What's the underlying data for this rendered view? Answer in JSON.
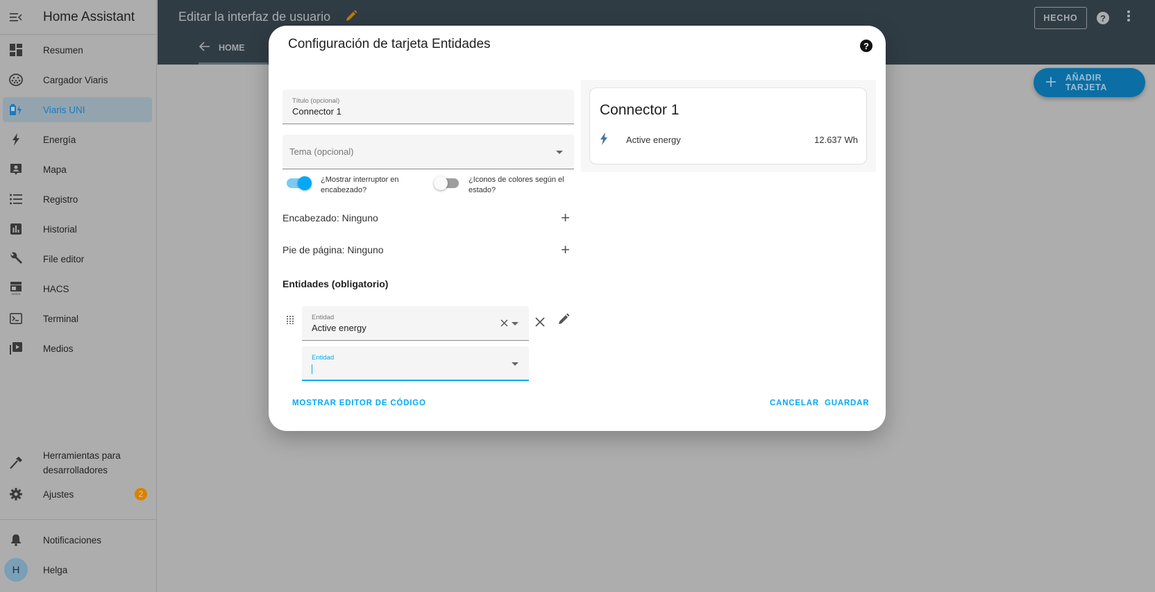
{
  "sidebar": {
    "app_title": "Home Assistant",
    "items": [
      {
        "label": "Resumen",
        "icon": "dashboard-icon"
      },
      {
        "label": "Cargador Viaris",
        "icon": "ev-plug-icon"
      },
      {
        "label": "Viaris UNI",
        "icon": "battery-charging-icon",
        "active": true
      },
      {
        "label": "Energía",
        "icon": "lightning-bolt-icon"
      },
      {
        "label": "Mapa",
        "icon": "map-account-icon"
      },
      {
        "label": "Registro",
        "icon": "list-icon"
      },
      {
        "label": "Historial",
        "icon": "chart-box-icon"
      },
      {
        "label": "File editor",
        "icon": "wrench-icon"
      },
      {
        "label": "HACS",
        "icon": "hacs-icon"
      },
      {
        "label": "Terminal",
        "icon": "console-icon"
      },
      {
        "label": "Medios",
        "icon": "media-icon"
      }
    ],
    "developer_tools": "Herramientas para desarrolladores",
    "settings": {
      "label": "Ajustes",
      "badge": "2"
    },
    "notifications": "Notificaciones",
    "user": {
      "name": "Helga",
      "initial": "H"
    }
  },
  "topbar": {
    "title": "Editar la interfaz de usuario",
    "tab": "HOME",
    "done_button": "HECHO"
  },
  "fab": {
    "label": "AÑADIR TARJETA"
  },
  "dialog": {
    "title": "Configuración de tarjeta Entidades",
    "title_field": {
      "label": "Título (opcional)",
      "value": "Connector 1"
    },
    "theme_field": {
      "placeholder": "Tema (opcional)"
    },
    "toggle_header": {
      "label": "¿Mostrar interruptor en encabezado?",
      "on": true
    },
    "toggle_colors": {
      "label": "¿Iconos de colores según el estado?",
      "on": false
    },
    "header_row": "Encabezado: Ninguno",
    "footer_row": "Pie de página: Ninguno",
    "entities_heading": "Entidades (obligatorio)",
    "entity_row": {
      "label": "Entidad",
      "value": "Active energy"
    },
    "entity_new": {
      "label": "Entidad",
      "value": ""
    },
    "preview": {
      "card_title": "Connector 1",
      "row_name": "Active energy",
      "row_state": "12.637 Wh"
    },
    "actions": {
      "code_editor": "MOSTRAR EDITOR DE CÓDIGO",
      "cancel": "CANCELAR",
      "save": "GUARDAR"
    }
  },
  "colors": {
    "accent": "#03a9f4",
    "topbar": "#303c44",
    "badge": "#d98200"
  }
}
